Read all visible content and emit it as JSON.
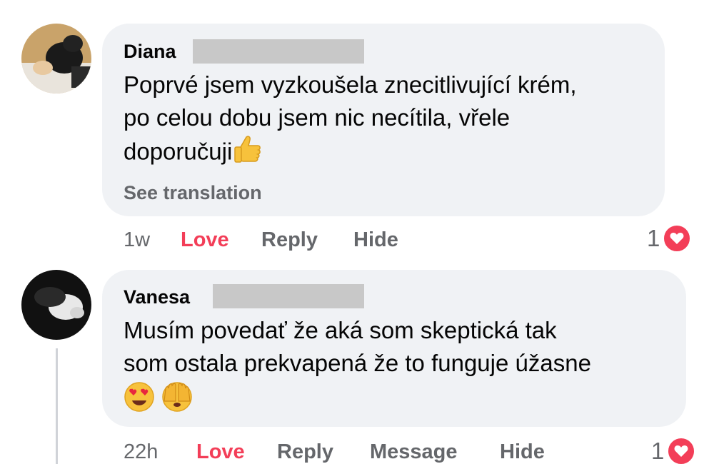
{
  "comments": [
    {
      "name": "Diana",
      "text_lines": [
        "Poprvé jsem vyzkoušela znecitlivující krém,",
        "po celou dobu jsem nic necítila, vřele",
        "doporučuji"
      ],
      "see_translation": "See translation",
      "time": "1w",
      "actions": [
        "Love",
        "Reply",
        "Hide"
      ],
      "reaction_count": "1",
      "emojis": [
        "thumbs-up"
      ]
    },
    {
      "name": "Vanesa",
      "text_lines": [
        "Musím povedať že aká som skeptická tak",
        "som ostala prekvapená že to funguje úžasne"
      ],
      "time": "22h",
      "actions": [
        "Love",
        "Reply",
        "Message",
        "Hide"
      ],
      "reaction_count": "1",
      "emojis": [
        "heart-eyes",
        "face-with-hands-over-eyes"
      ]
    }
  ],
  "colors": {
    "love": "#f33e58",
    "bubble": "#f0f2f5",
    "muted": "#65676b"
  }
}
